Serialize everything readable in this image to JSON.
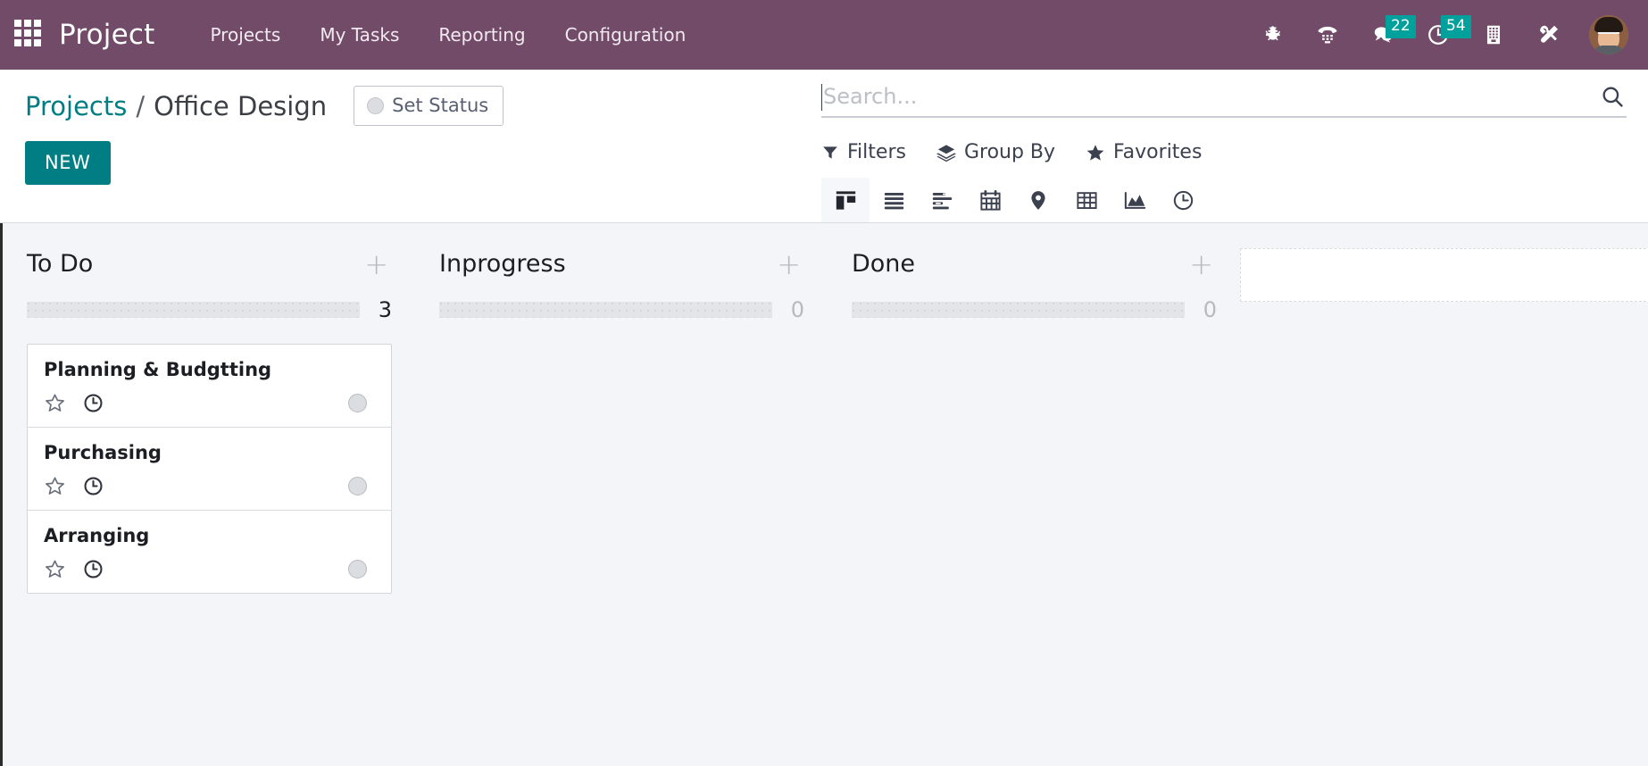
{
  "navbar": {
    "apps_icon": "apps-grid-icon",
    "brand": "Project",
    "menu": [
      {
        "label": "Projects"
      },
      {
        "label": "My Tasks"
      },
      {
        "label": "Reporting"
      },
      {
        "label": "Configuration"
      }
    ],
    "system_icons": [
      {
        "name": "bug-icon",
        "badge": null
      },
      {
        "name": "phone-dialpad-icon",
        "badge": null
      },
      {
        "name": "messages-icon",
        "badge": "22"
      },
      {
        "name": "activities-clock-icon",
        "badge": "54"
      },
      {
        "name": "company-building-icon",
        "badge": null
      },
      {
        "name": "developer-tools-icon",
        "badge": null
      }
    ],
    "avatar_alt": "user-avatar",
    "accent_color": "#714b67",
    "badge_color": "#00a09d"
  },
  "control_panel": {
    "breadcrumb": {
      "root": "Projects",
      "separator": "/",
      "current": "Office Design"
    },
    "status_button": {
      "label": "Set Status",
      "icon": "status-circle-icon"
    },
    "new_button": {
      "label": "NEW",
      "color": "#017e84"
    },
    "search": {
      "placeholder": "Search...",
      "value": "",
      "icon": "search-icon"
    },
    "filter_buttons": [
      {
        "label": "Filters",
        "icon": "filter-funnel-icon"
      },
      {
        "label": "Group By",
        "icon": "group-by-layers-icon"
      },
      {
        "label": "Favorites",
        "icon": "star-icon"
      }
    ],
    "view_switcher": {
      "active": "kanban",
      "views": [
        {
          "name": "kanban",
          "icon": "kanban-view-icon"
        },
        {
          "name": "list",
          "icon": "list-view-icon"
        },
        {
          "name": "gantt",
          "icon": "gantt-view-icon"
        },
        {
          "name": "calendar",
          "icon": "calendar-view-icon"
        },
        {
          "name": "map",
          "icon": "map-pin-view-icon"
        },
        {
          "name": "pivot",
          "icon": "pivot-view-icon"
        },
        {
          "name": "graph",
          "icon": "graph-view-icon"
        },
        {
          "name": "activity",
          "icon": "activity-clock-view-icon"
        }
      ]
    }
  },
  "kanban": {
    "columns": [
      {
        "title": "To Do",
        "count": "3",
        "add_icon": "plus-icon",
        "cards": [
          {
            "title": "Planning & Budgtting",
            "star_icon": "star-outline-icon",
            "clock_icon": "clock-icon",
            "avatar": "assignee-avatar"
          },
          {
            "title": "Purchasing",
            "star_icon": "star-outline-icon",
            "clock_icon": "clock-icon",
            "avatar": "assignee-avatar"
          },
          {
            "title": "Arranging",
            "star_icon": "star-outline-icon",
            "clock_icon": "clock-icon",
            "avatar": "assignee-avatar"
          }
        ]
      },
      {
        "title": "Inprogress",
        "count": "0",
        "add_icon": "plus-icon",
        "cards": []
      },
      {
        "title": "Done",
        "count": "0",
        "add_icon": "plus-icon",
        "cards": []
      }
    ]
  }
}
